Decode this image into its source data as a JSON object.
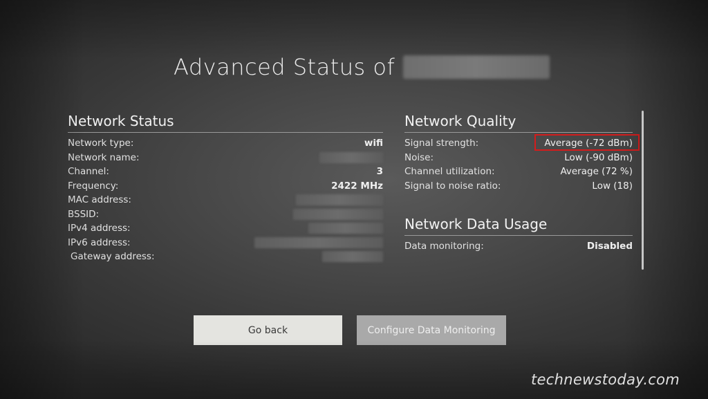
{
  "title": "Advanced Status of",
  "network_status": {
    "heading": "Network Status",
    "rows": [
      {
        "label": "Network type:",
        "value": "wifi"
      },
      {
        "label": "Network name:",
        "value": ""
      },
      {
        "label": "Channel:",
        "value": "3"
      },
      {
        "label": "Frequency:",
        "value": "2422 MHz"
      },
      {
        "label": "MAC address:",
        "value": ""
      },
      {
        "label": "BSSID:",
        "value": ""
      },
      {
        "label": "IPv4 address:",
        "value": ""
      },
      {
        "label": "IPv6 address:",
        "value": ""
      },
      {
        "label": "Gateway address:",
        "value": ""
      }
    ]
  },
  "network_quality": {
    "heading": "Network Quality",
    "rows": [
      {
        "label": "Signal strength:",
        "value": "Average (-72 dBm)"
      },
      {
        "label": "Noise:",
        "value": "Low (-90 dBm)"
      },
      {
        "label": "Channel utilization:",
        "value": "Average (72 %)"
      },
      {
        "label": "Signal to noise ratio:",
        "value": "Low (18)"
      }
    ]
  },
  "network_data_usage": {
    "heading": "Network Data Usage",
    "rows": [
      {
        "label": "Data monitoring:",
        "value": "Disabled"
      }
    ]
  },
  "buttons": {
    "go_back": "Go back",
    "configure": "Configure Data Monitoring"
  },
  "watermark": "technewstoday.com",
  "colors": {
    "highlight": "#d41c1c",
    "primary_button": "#e4e4e0",
    "secondary_button": "#a9a9a9"
  }
}
